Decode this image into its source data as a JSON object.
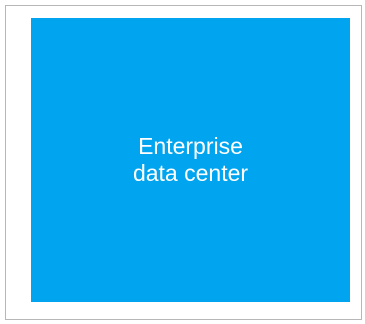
{
  "colors": {
    "node_fill": "#00a4ef",
    "border": "#b7b7b7",
    "background": "#ffffff",
    "label_text": "#ffffff"
  },
  "node": {
    "label": "Enterprise\ndata center"
  }
}
